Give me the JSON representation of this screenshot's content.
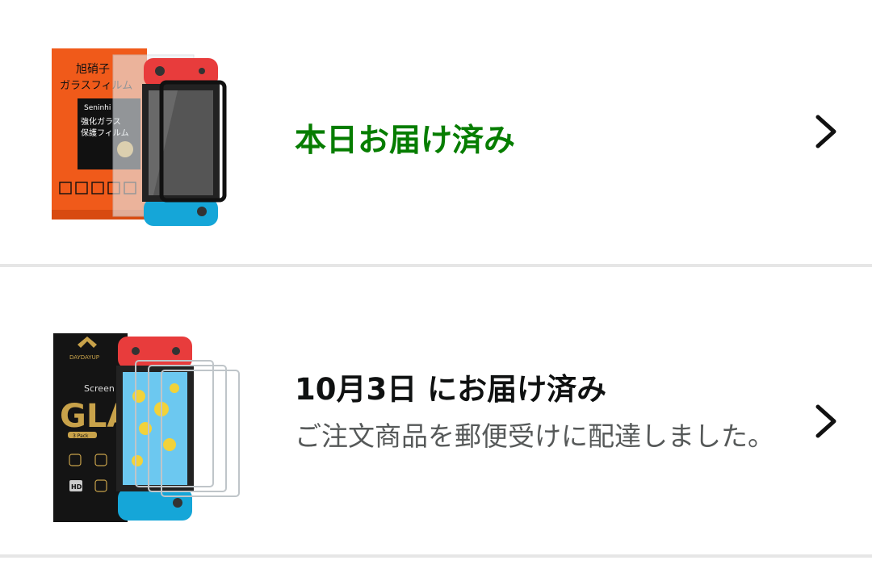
{
  "orders": [
    {
      "status": "本日お届け済み",
      "detail": "",
      "status_color": "#067d00",
      "product": {
        "package_lines": [
          "旭硝子",
          "ガラスフィルム",
          "Seninhi",
          "強化ガラス",
          "保護フィルム"
        ],
        "accent_color": "#f05a1a"
      },
      "icon": "chevron-right-icon"
    },
    {
      "status": "10月3日 にお届け済み",
      "detail": "ご注文商品を郵便受けに配達しました。",
      "status_color": "#0f1111",
      "product": {
        "package_lines": [
          "DAYDAYUP",
          "Screen P",
          "GLA",
          "3 Pack",
          "HD"
        ],
        "accent_color": "#c8a24a"
      },
      "icon": "chevron-right-icon"
    }
  ]
}
